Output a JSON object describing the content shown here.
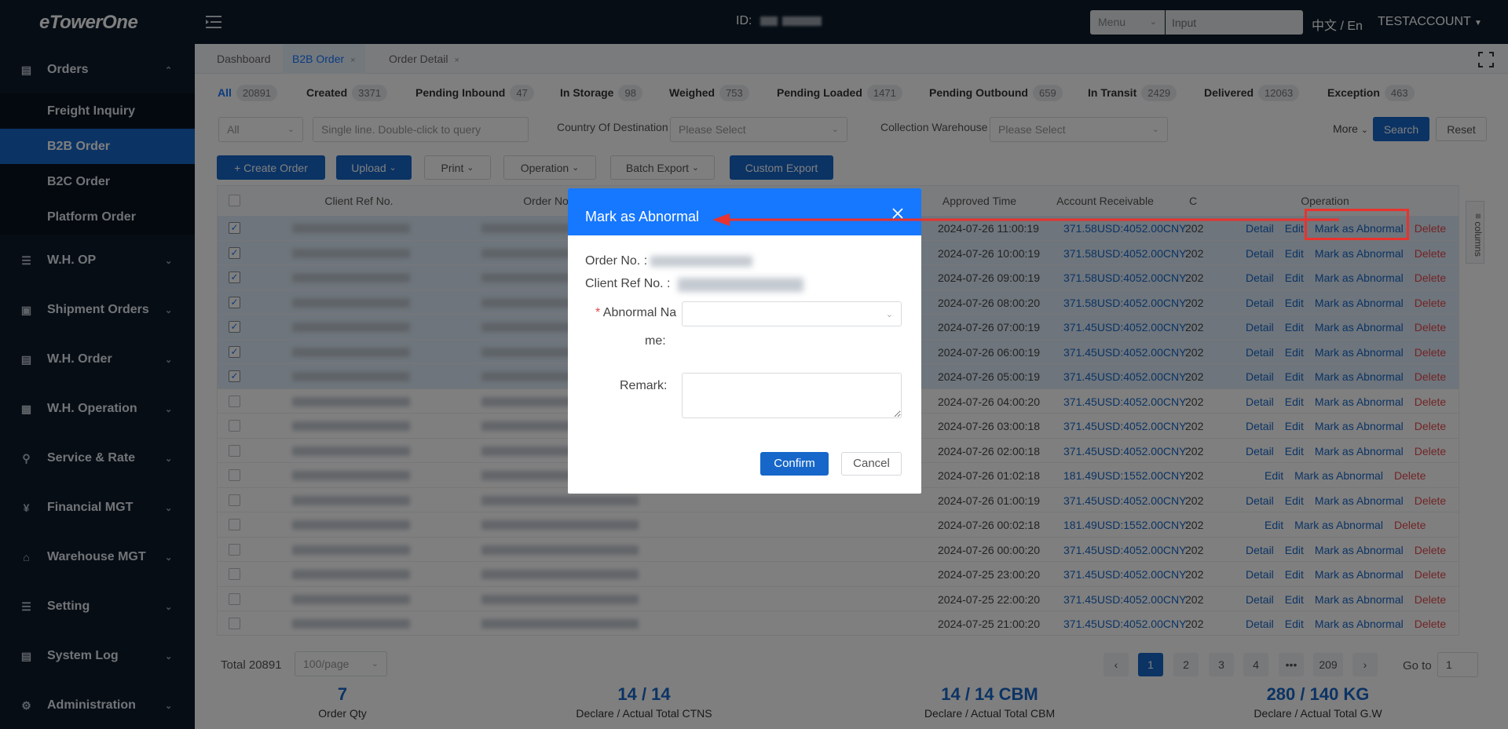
{
  "app": {
    "logo": "eTowerOne"
  },
  "topbar": {
    "id_label": "ID:",
    "menu_select": "Menu",
    "search_placeholder": "Input",
    "lang": "中文 / En",
    "account": "TESTACCOUNT"
  },
  "sidebar": {
    "orders": "Orders",
    "sub_items": [
      "Freight Inquiry",
      "B2B Order",
      "B2C Order",
      "Platform Order"
    ],
    "items": [
      "W.H. OP",
      "Shipment Orders",
      "W.H. Order",
      "W.H. Operation",
      "Service & Rate",
      "Financial MGT",
      "Warehouse MGT",
      "Setting",
      "System Log",
      "Administration"
    ]
  },
  "tabs": [
    "Dashboard",
    "B2B Order",
    "Order Detail"
  ],
  "statuses": [
    {
      "label": "All",
      "count": "20891"
    },
    {
      "label": "Created",
      "count": "3371"
    },
    {
      "label": "Pending Inbound",
      "count": "47"
    },
    {
      "label": "In Storage",
      "count": "98"
    },
    {
      "label": "Weighed",
      "count": "753"
    },
    {
      "label": "Pending Loaded",
      "count": "1471"
    },
    {
      "label": "Pending Outbound",
      "count": "659"
    },
    {
      "label": "In Transit",
      "count": "2429"
    },
    {
      "label": "Delivered",
      "count": "12063"
    },
    {
      "label": "Exception",
      "count": "463"
    }
  ],
  "filters": {
    "type_select": "All",
    "query_placeholder": "Single line. Double-click to query",
    "country_label": "Country Of Destination",
    "country_placeholder": "Please Select",
    "warehouse_label": "Collection Warehouse",
    "warehouse_placeholder": "Please Select",
    "more": "More",
    "search": "Search",
    "reset": "Reset"
  },
  "toolbar": {
    "create": "+ Create Order",
    "upload": "Upload",
    "print": "Print",
    "operation": "Operation",
    "batch_export": "Batch Export",
    "custom_export": "Custom Export"
  },
  "table": {
    "headers": {
      "client_ref": "Client Ref No.",
      "order_no": "Order No.",
      "approved_time": "Approved Time",
      "account_receivable": "Account Receivable",
      "c": "C",
      "operation": "Operation"
    },
    "columns_btn": "columns",
    "ops": {
      "detail": "Detail",
      "edit": "Edit",
      "mark": "Mark as Abnormal",
      "delete": "Delete"
    },
    "rows": [
      {
        "time": "2024-07-26 11:00:19",
        "ar": "371.58USD:4052.00CNY",
        "c": "202",
        "selected": true,
        "detail": true
      },
      {
        "time": "2024-07-26 10:00:19",
        "ar": "371.58USD:4052.00CNY",
        "c": "202",
        "selected": true,
        "detail": true
      },
      {
        "time": "2024-07-26 09:00:19",
        "ar": "371.58USD:4052.00CNY",
        "c": "202",
        "selected": true,
        "detail": true
      },
      {
        "time": "2024-07-26 08:00:20",
        "ar": "371.58USD:4052.00CNY",
        "c": "202",
        "selected": true,
        "detail": true
      },
      {
        "time": "2024-07-26 07:00:19",
        "ar": "371.45USD:4052.00CNY",
        "c": "202",
        "selected": true,
        "detail": true
      },
      {
        "time": "2024-07-26 06:00:19",
        "ar": "371.45USD:4052.00CNY",
        "c": "202",
        "selected": true,
        "detail": true
      },
      {
        "time": "2024-07-26 05:00:19",
        "ar": "371.45USD:4052.00CNY",
        "c": "202",
        "selected": true,
        "detail": true
      },
      {
        "time": "2024-07-26 04:00:20",
        "ar": "371.45USD:4052.00CNY",
        "c": "202",
        "selected": false,
        "detail": true
      },
      {
        "time": "2024-07-26 03:00:18",
        "ar": "371.45USD:4052.00CNY",
        "c": "202",
        "selected": false,
        "detail": true
      },
      {
        "time": "2024-07-26 02:00:18",
        "ar": "371.45USD:4052.00CNY",
        "c": "202",
        "selected": false,
        "detail": true
      },
      {
        "time": "2024-07-26 01:02:18",
        "ar": "181.49USD:1552.00CNY:",
        "c": "202",
        "selected": false,
        "detail": false
      },
      {
        "time": "2024-07-26 01:00:19",
        "ar": "371.45USD:4052.00CNY",
        "c": "202",
        "selected": false,
        "detail": true
      },
      {
        "time": "2024-07-26 00:02:18",
        "ar": "181.49USD:1552.00CNY:",
        "c": "202",
        "selected": false,
        "detail": false
      },
      {
        "time": "2024-07-26 00:00:20",
        "ar": "371.45USD:4052.00CNY",
        "c": "202",
        "selected": false,
        "detail": true
      },
      {
        "time": "2024-07-25 23:00:20",
        "ar": "371.45USD:4052.00CNY",
        "c": "202",
        "selected": false,
        "detail": true
      },
      {
        "time": "2024-07-25 22:00:20",
        "ar": "371.45USD:4052.00CNY",
        "c": "202",
        "selected": false,
        "detail": true
      },
      {
        "time": "2024-07-25 21:00:20",
        "ar": "371.45USD:4052.00CNY",
        "c": "202",
        "selected": false,
        "detail": true
      }
    ]
  },
  "pager": {
    "total": "Total 20891",
    "page_size": "100/page",
    "pages": [
      "1",
      "2",
      "3",
      "4",
      "•••",
      "209"
    ],
    "goto_label": "Go to",
    "goto_value": "1"
  },
  "summary": [
    {
      "value": "7",
      "label": "Order Qty"
    },
    {
      "value": "14 / 14",
      "label": "Declare / Actual Total CTNS"
    },
    {
      "value": "14 / 14 CBM",
      "label": "Declare / Actual Total CBM"
    },
    {
      "value": "280 / 140 KG",
      "label": "Declare / Actual Total G.W"
    }
  ],
  "dialog": {
    "title": "Mark as Abnormal",
    "order_no_label": "Order No. :",
    "client_ref_label": "Client Ref No. :",
    "required_mark": "*",
    "abnormal_label_1": "Abnormal Na",
    "abnormal_label_2": "me:",
    "remark_label": "Remark:",
    "confirm": "Confirm",
    "cancel": "Cancel"
  },
  "colors": {
    "primary": "#1667c9",
    "dark_bg": "#0d1b2a",
    "danger": "#e5484d",
    "annotation": "#e8332e"
  }
}
